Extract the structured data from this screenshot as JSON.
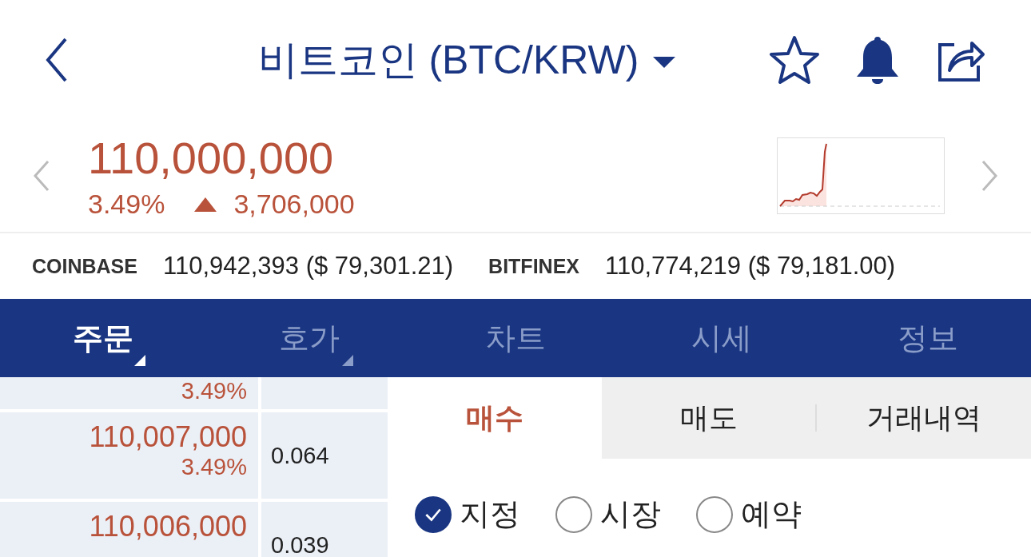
{
  "header": {
    "title": "비트코인 (BTC/KRW)",
    "favorite": false
  },
  "price": {
    "current": "110,000,000",
    "change_rate": "3.49%",
    "change_amount": "3,706,000"
  },
  "exchanges": [
    {
      "name": "COINBASE",
      "value": "110,942,393 ($ 79,301.21)"
    },
    {
      "name": "BITFINEX",
      "value": "110,774,219 ($ 79,181.00)"
    }
  ],
  "nav_tabs": [
    {
      "label": "주문",
      "selected": true,
      "dropdown": true
    },
    {
      "label": "호가",
      "selected": false,
      "dropdown": true
    },
    {
      "label": "차트",
      "selected": false,
      "dropdown": false
    },
    {
      "label": "시세",
      "selected": false,
      "dropdown": false
    },
    {
      "label": "정보",
      "selected": false,
      "dropdown": false
    }
  ],
  "order_book": [
    {
      "change": "3.49%"
    },
    {
      "price": "110,007,000",
      "change": "3.49%",
      "quantity": "0.064"
    },
    {
      "price": "110,006,000",
      "quantity": "0.039"
    }
  ],
  "order_tabs": [
    {
      "label": "매수",
      "selected": true
    },
    {
      "label": "매도",
      "selected": false
    },
    {
      "label": "거래내역",
      "selected": false
    }
  ],
  "order_types": [
    {
      "label": "지정",
      "selected": true
    },
    {
      "label": "시장",
      "selected": false
    },
    {
      "label": "예약",
      "selected": false
    }
  ]
}
